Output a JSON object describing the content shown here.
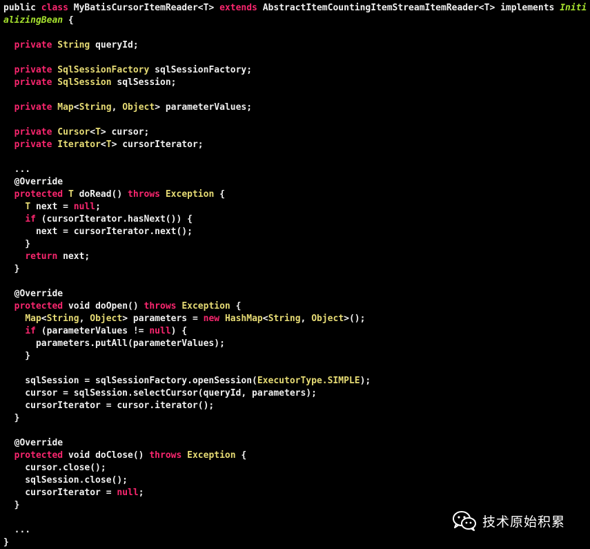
{
  "colors": {
    "background": "#000000",
    "plain": "#f0f0f0",
    "keyword": "#f9266e",
    "type": "#e6db74",
    "interface": "#a6e22e"
  },
  "code_lines": [
    [
      [
        "plain",
        "public "
      ],
      [
        "kw",
        "class "
      ],
      [
        "plain",
        "MyBatisCursorItemReader<T> "
      ],
      [
        "kw",
        "extends "
      ],
      [
        "plain",
        "AbstractItemCountingItemStreamItemReader<T> implements "
      ],
      [
        "iface",
        "Initi"
      ]
    ],
    [
      [
        "iface",
        "alizingBean"
      ],
      [
        "plain",
        " {"
      ]
    ],
    [],
    [
      [
        "plain",
        "  "
      ],
      [
        "kw",
        "private "
      ],
      [
        "type",
        "String "
      ],
      [
        "plain",
        "queryId;"
      ]
    ],
    [],
    [
      [
        "plain",
        "  "
      ],
      [
        "kw",
        "private "
      ],
      [
        "type",
        "SqlSessionFactory "
      ],
      [
        "plain",
        "sqlSessionFactory;"
      ]
    ],
    [
      [
        "plain",
        "  "
      ],
      [
        "kw",
        "private "
      ],
      [
        "type",
        "SqlSession "
      ],
      [
        "plain",
        "sqlSession;"
      ]
    ],
    [],
    [
      [
        "plain",
        "  "
      ],
      [
        "kw",
        "private "
      ],
      [
        "type",
        "Map"
      ],
      [
        "plain",
        "<"
      ],
      [
        "type",
        "String"
      ],
      [
        "plain",
        ", "
      ],
      [
        "type",
        "Object"
      ],
      [
        "plain",
        "> parameterValues;"
      ]
    ],
    [],
    [
      [
        "plain",
        "  "
      ],
      [
        "kw",
        "private "
      ],
      [
        "type",
        "Cursor"
      ],
      [
        "plain",
        "<"
      ],
      [
        "type",
        "T"
      ],
      [
        "plain",
        "> cursor;"
      ]
    ],
    [
      [
        "plain",
        "  "
      ],
      [
        "kw",
        "private "
      ],
      [
        "type",
        "Iterator"
      ],
      [
        "plain",
        "<"
      ],
      [
        "type",
        "T"
      ],
      [
        "plain",
        "> cursorIterator;"
      ]
    ],
    [],
    [
      [
        "plain",
        "  ..."
      ]
    ],
    [
      [
        "plain",
        "  @Override"
      ]
    ],
    [
      [
        "plain",
        "  "
      ],
      [
        "kw",
        "protected "
      ],
      [
        "type",
        "T "
      ],
      [
        "plain",
        "doRead() "
      ],
      [
        "kw",
        "throws "
      ],
      [
        "type",
        "Exception "
      ],
      [
        "plain",
        "{"
      ]
    ],
    [
      [
        "plain",
        "    "
      ],
      [
        "type",
        "T "
      ],
      [
        "plain",
        "next = "
      ],
      [
        "kw",
        "null"
      ],
      [
        "plain",
        ";"
      ]
    ],
    [
      [
        "plain",
        "    "
      ],
      [
        "kw",
        "if "
      ],
      [
        "plain",
        "(cursorIterator.hasNext()) {"
      ]
    ],
    [
      [
        "plain",
        "      next = cursorIterator.next();"
      ]
    ],
    [
      [
        "plain",
        "    }"
      ]
    ],
    [
      [
        "plain",
        "    "
      ],
      [
        "kw",
        "return "
      ],
      [
        "plain",
        "next;"
      ]
    ],
    [
      [
        "plain",
        "  }"
      ]
    ],
    [],
    [
      [
        "plain",
        "  @Override"
      ]
    ],
    [
      [
        "plain",
        "  "
      ],
      [
        "kw",
        "protected "
      ],
      [
        "plain",
        "void doOpen() "
      ],
      [
        "kw",
        "throws "
      ],
      [
        "type",
        "Exception "
      ],
      [
        "plain",
        "{"
      ]
    ],
    [
      [
        "plain",
        "    "
      ],
      [
        "type",
        "Map"
      ],
      [
        "plain",
        "<"
      ],
      [
        "type",
        "String"
      ],
      [
        "plain",
        ", "
      ],
      [
        "type",
        "Object"
      ],
      [
        "plain",
        "> parameters = "
      ],
      [
        "kw",
        "new "
      ],
      [
        "type",
        "HashMap"
      ],
      [
        "plain",
        "<"
      ],
      [
        "type",
        "String"
      ],
      [
        "plain",
        ", "
      ],
      [
        "type",
        "Object"
      ],
      [
        "plain",
        ">();"
      ]
    ],
    [
      [
        "plain",
        "    "
      ],
      [
        "kw",
        "if "
      ],
      [
        "plain",
        "(parameterValues != "
      ],
      [
        "kw",
        "null"
      ],
      [
        "plain",
        ") {"
      ]
    ],
    [
      [
        "plain",
        "      parameters.putAll(parameterValues);"
      ]
    ],
    [
      [
        "plain",
        "    }"
      ]
    ],
    [],
    [
      [
        "plain",
        "    sqlSession = sqlSessionFactory.openSession("
      ],
      [
        "type",
        "ExecutorType.SIMPLE"
      ],
      [
        "plain",
        ");"
      ]
    ],
    [
      [
        "plain",
        "    cursor = sqlSession.selectCursor(queryId, parameters);"
      ]
    ],
    [
      [
        "plain",
        "    cursorIterator = cursor.iterator();"
      ]
    ],
    [
      [
        "plain",
        "  }"
      ]
    ],
    [],
    [
      [
        "plain",
        "  @Override"
      ]
    ],
    [
      [
        "plain",
        "  "
      ],
      [
        "kw",
        "protected "
      ],
      [
        "plain",
        "void doClose() "
      ],
      [
        "kw",
        "throws "
      ],
      [
        "type",
        "Exception "
      ],
      [
        "plain",
        "{"
      ]
    ],
    [
      [
        "plain",
        "    cursor.close();"
      ]
    ],
    [
      [
        "plain",
        "    sqlSession.close();"
      ]
    ],
    [
      [
        "plain",
        "    cursorIterator = "
      ],
      [
        "kw",
        "null"
      ],
      [
        "plain",
        ";"
      ]
    ],
    [
      [
        "plain",
        "  }"
      ]
    ],
    [],
    [
      [
        "plain",
        "  ..."
      ]
    ],
    [
      [
        "plain",
        "}"
      ]
    ]
  ],
  "watermark": {
    "icon": "wechat-icon",
    "text": "技术原始积累"
  }
}
